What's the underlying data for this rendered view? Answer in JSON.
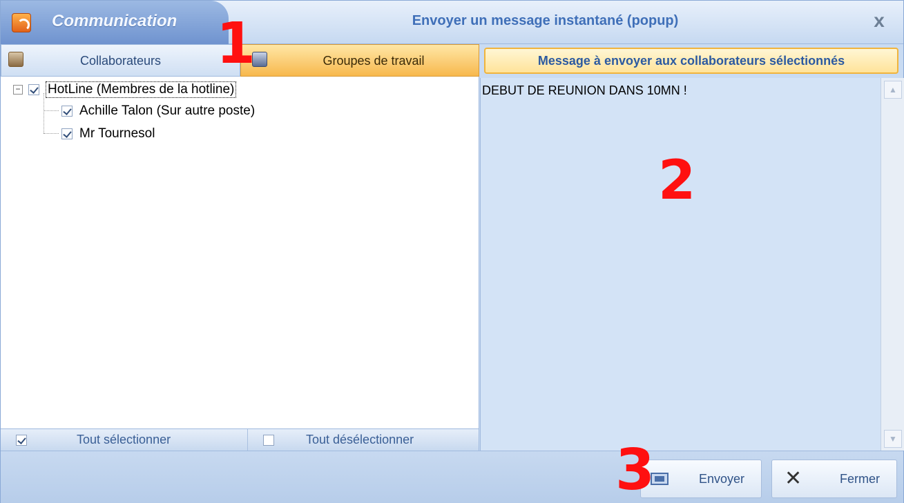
{
  "titlebar": {
    "app_name": "Communication",
    "app_icon": "rss-feed-icon",
    "window_title": "Envoyer un message instantané (popup)",
    "close_glyph": "x"
  },
  "tabs": [
    {
      "label": "Collaborateurs",
      "icon": "user-icon",
      "active": false
    },
    {
      "label": "Groupes de travail",
      "icon": "group-icon",
      "active": true
    }
  ],
  "tree": {
    "root": {
      "label": "HotLine (Membres de la hotline)",
      "checked": true,
      "expanded": true,
      "expander": "−"
    },
    "children": [
      {
        "label": "Achille Talon (Sur autre poste)",
        "checked": true
      },
      {
        "label": "Mr Tournesol",
        "checked": true
      }
    ]
  },
  "selection": {
    "select_all": "Tout sélectionner",
    "deselect_all": "Tout désélectionner"
  },
  "message": {
    "header": "Message à envoyer aux collaborateurs sélectionnés",
    "body": "DEBUT DE REUNION DANS 10MN !"
  },
  "footer": {
    "send_label": "Envoyer",
    "close_label": "Fermer"
  },
  "annotations": [
    "1",
    "2",
    "3"
  ],
  "colors": {
    "active_tab": "#f7b84d",
    "message_bg": "#d3e3f6",
    "annotation": "#ff1010",
    "title_text": "#3f6fb8"
  }
}
